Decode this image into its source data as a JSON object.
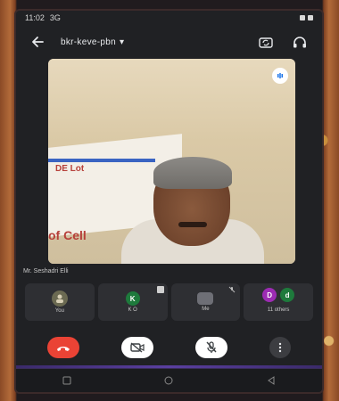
{
  "status_bar": {
    "time": "11:02",
    "extra": "3G"
  },
  "toolbar": {
    "meeting_code": "bkr-keve-pbn",
    "dropdown_glyph": "▾"
  },
  "video": {
    "speaker_name": "Mr. Seshadri Elli",
    "banner_lines": [
      "DE Lot",
      "",
      "",
      "of Cell"
    ]
  },
  "tiles": [
    {
      "name": "You",
      "kind": "self"
    },
    {
      "name": "K O",
      "kind": "avatar",
      "initial": "K"
    },
    {
      "name": "Me",
      "kind": "mic"
    },
    {
      "name": "11 others",
      "kind": "group",
      "initials": [
        "D",
        "d"
      ]
    }
  ],
  "colors": {
    "end_call": "#ea4335",
    "avatar_k": "#1e7a3c",
    "avatar_d": "#9c2bb3",
    "background": "#202124"
  }
}
